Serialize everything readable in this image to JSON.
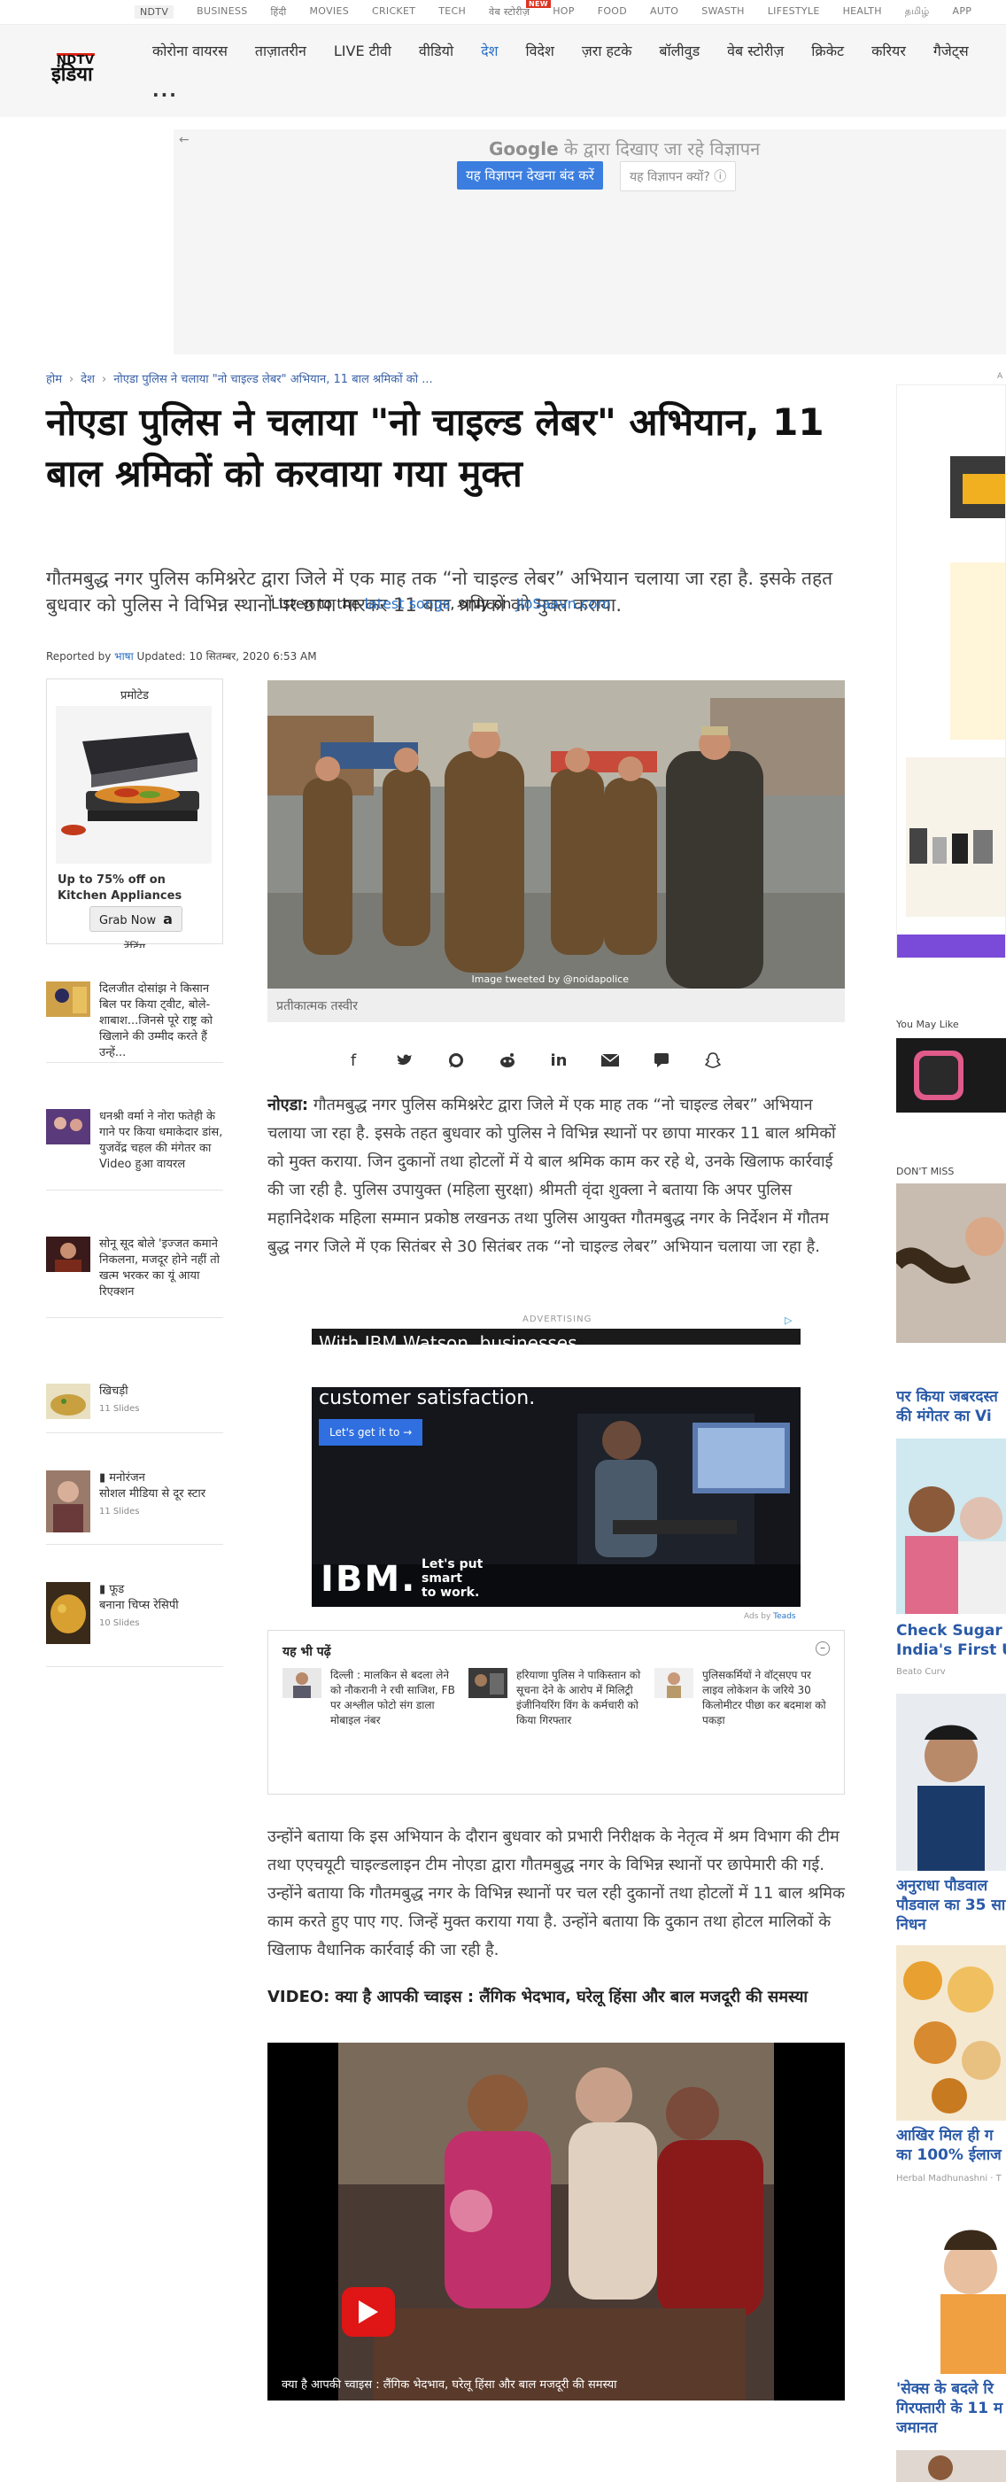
{
  "top_strip": {
    "items": [
      "NDTV",
      "BUSINESS",
      "हिंदी",
      "MOVIES",
      "CRICKET",
      "TECH",
      "वेब स्टोरीज़",
      "HOP",
      "FOOD",
      "AUTO",
      "SWASTH",
      "LIFESTYLE",
      "HEALTH",
      "தமிழ்",
      "APP"
    ],
    "new_badge": "NEW"
  },
  "header": {
    "logo_top": "NDTV",
    "logo_bottom": "इंडिया",
    "nav": [
      "कोरोना वायरस",
      "ताज़ातरीन",
      "LIVE टीवी",
      "वीडियो",
      "देश",
      "विदेश",
      "ज़रा हटके",
      "बॉलीवुड",
      "वेब स्टोरीज़",
      "क्रिकेट",
      "करियर",
      "गैजेट्स"
    ],
    "more": "..."
  },
  "google_ad": {
    "back": "←",
    "brand": "Google",
    "line": "के द्वारा दिखाए जा रहे विज्ञापन",
    "stop_button": "यह विज्ञापन देखना बंद करें",
    "why_button": "यह विज्ञापन क्यों? ⓘ"
  },
  "breadcrumb": [
    "होम",
    "देश",
    "नोएडा पुलिस ने चलाया \"नो चाइल्ड लेबर\" अभियान, 11 बाल श्रमिकों को ..."
  ],
  "article": {
    "title": "नोएडा पुलिस ने चलाया \"नो चाइल्ड लेबर\" अभियान, 11 बाल श्रमिकों को करवाया गया मुक्त",
    "summary": "गौतमबुद्ध नगर पुलिस कमिश्नरेट द्वारा जिले में एक माह तक “नो चाइल्ड लेबर” अभियान चलाया जा रहा है. इसके तहत बुधवार को पुलिस ने विभिन्न स्थानों पर छापा मारकर 11 बाल श्रमिकों को मुक्त कराया.",
    "jiosaavn_pre": "Listen to the ",
    "jiosaavn_link": "latest songs",
    "jiosaavn_mid": ", only on ",
    "jiosaavn_site": "JioSaavn.com",
    "reported_by": "Reported by ",
    "agency": "भाषा",
    "updated": " Updated: 10 सितम्बर, 2020 6:53 AM",
    "image_credit": "Image tweeted by @noidapolice",
    "image_caption": "प्रतीकात्मक तस्वीर",
    "para1_lead": "नोएडा:",
    "para1": " गौतमबुद्ध नगर पुलिस कमिश्नरेट द्वारा जिले में एक माह तक “नो चाइल्ड लेबर” अभियान चलाया जा रहा है. इसके तहत बुधवार को पुलिस ने विभिन्न स्थानों पर छापा मारकर 11 बाल श्रमिकों को मुक्त कराया. जिन दुकानों तथा होटलों में ये बाल श्रमिक काम कर रहे थे, उनके खिलाफ कार्रवाई की जा रही है. पुलिस उपायुक्त (महिला सुरक्षा) श्रीमती वृंदा शुक्ला ने बताया कि अपर पुलिस महानिदेशक महिला सम्मान प्रकोष्ठ लखनऊ तथा पुलिस आयुक्त गौतमबुद्ध नगर के निर्देशन में गौतम बुद्ध नगर जिले में एक सितंबर से 30 सितंबर तक “नो चाइल्ड लेबर” अभियान चलाया जा रहा है.",
    "para2": "उन्होंने बताया कि इस अभियान के दौरान बुधवार को प्रभारी निरीक्षक के नेतृत्व में श्रम विभाग की टीम तथा एएचयूटी चाइल्डलाइन टीम नोएडा द्वारा गौतमबुद्ध नगर के विभिन्न स्थानों पर छापेमारी की गई. उन्होंने बताया कि गौतमबुद्ध नगर के विभिन्न स्थानों पर चल रही दुकानों तथा होटलों में 11 बाल श्रमिक काम करते हुए पाए गए. जिन्हें मुक्त कराया गया है. उन्होंने बताया कि दुकान तथा होटल मालिकों के खिलाफ वैधानिक कार्रवाई की जा रही है.",
    "video_title": "VIDEO: क्या है आपकी च्वाइस : लैंगिक भेदभाव, घरेलू हिंसा और बाल मजदूरी की समस्या",
    "video_caption": "क्या है आपकी च्वाइस : लैंगिक भेदभाव, घरेलू हिंसा और बाल मजदूरी की समस्या"
  },
  "share_icons": [
    "facebook-icon",
    "twitter-icon",
    "whatsapp-icon",
    "reddit-icon",
    "linkedin-icon",
    "email-icon",
    "comment-icon",
    "snapchat-icon"
  ],
  "promo": {
    "label": "प्रमोटेड",
    "text": "Up to 75% off on Kitchen Appliances",
    "button": "Grab Now",
    "amazon": "a",
    "cut_text": "ट्रेंडिंग"
  },
  "side_stories": [
    {
      "text": "दिलजीत दोसांझ ने किसान बिल पर किया ट्वीट, बोले- शाबाश...जिनसे पूरे राष्ट्र को खिलाने की उम्मीद करते हैं उन्हें...",
      "sub": ""
    },
    {
      "text": "धनश्री वर्मा ने नोरा फतेही के गाने पर किया धमाकेदार डांस, युजवेंद्र चहल की मंगेतर का Video हुआ वायरल",
      "sub": ""
    },
    {
      "text": "सोनू सूद बोले 'इज्जत कमाने निकलना, मजदूर होने नहीं तो खत्म भरकर का यूं आया रिएक्शन",
      "sub": ""
    },
    {
      "text": "खिचड़ी",
      "sub": "11 Slides"
    },
    {
      "text": "▮ मनोरंजन\nसोशल मीडिया से दूर स्टार",
      "sub": "11 Slides"
    },
    {
      "text": "▮ फूड\nबनाना चिप्स रेसिपी",
      "sub": "10 Slides"
    }
  ],
  "ibm_ad": {
    "advertising": "ADVERTISING",
    "top_text": "With IBM Watson, businesses",
    "tagline": "customer satisfaction.",
    "cta": "Let's get it to →",
    "logo": "IBM.",
    "smart": "Let's put\nsmart\nto work.",
    "ads_by": "Ads by ",
    "ads_by_brand": "Teads"
  },
  "also_read": {
    "heading": "यह भी पढ़ें",
    "close": "–",
    "items": [
      "दिल्ली : मालकिन से बदला लेने को नौकरानी ने रची साजिश, FB पर अश्लील फोटो संग डाला मोबाइल नंबर",
      "हरियाणा पुलिस ने पाकिस्तान को सूचना देने के आरोप में मिलिट्री इंजीनियरिंग विंग के कर्मचारी को किया गिरफ्तार",
      "पुलिसकर्मियों ने वॉट्सएप पर लाइव लोकेशन के जरिये 30 किलोमीटर पीछा कर बदमाश को पकड़ा"
    ]
  },
  "right_rail": {
    "ad_label": "A",
    "you_may_like": "You May Like",
    "dont_miss": "DON'T MISS",
    "story1": "पर किया जबरदस्त",
    "story1b": "की मंगेतर का Vi",
    "story2": "Check Sugar L",
    "story2b": "India's First US",
    "src2": "Beato Curv",
    "story3": "अनुराधा पौडवाल",
    "story3b": "पौडवाल का 35 सा",
    "story3c": "निधन",
    "story4": "आखिर मिल ही ग",
    "story4b": "का 100% ईलाज",
    "src4": "Herbal Madhunashni · T",
    "story5": "'सेक्स के बदले रि",
    "story5b": "गिरफ्तारी के 11 म",
    "story5c": "जमानत"
  }
}
